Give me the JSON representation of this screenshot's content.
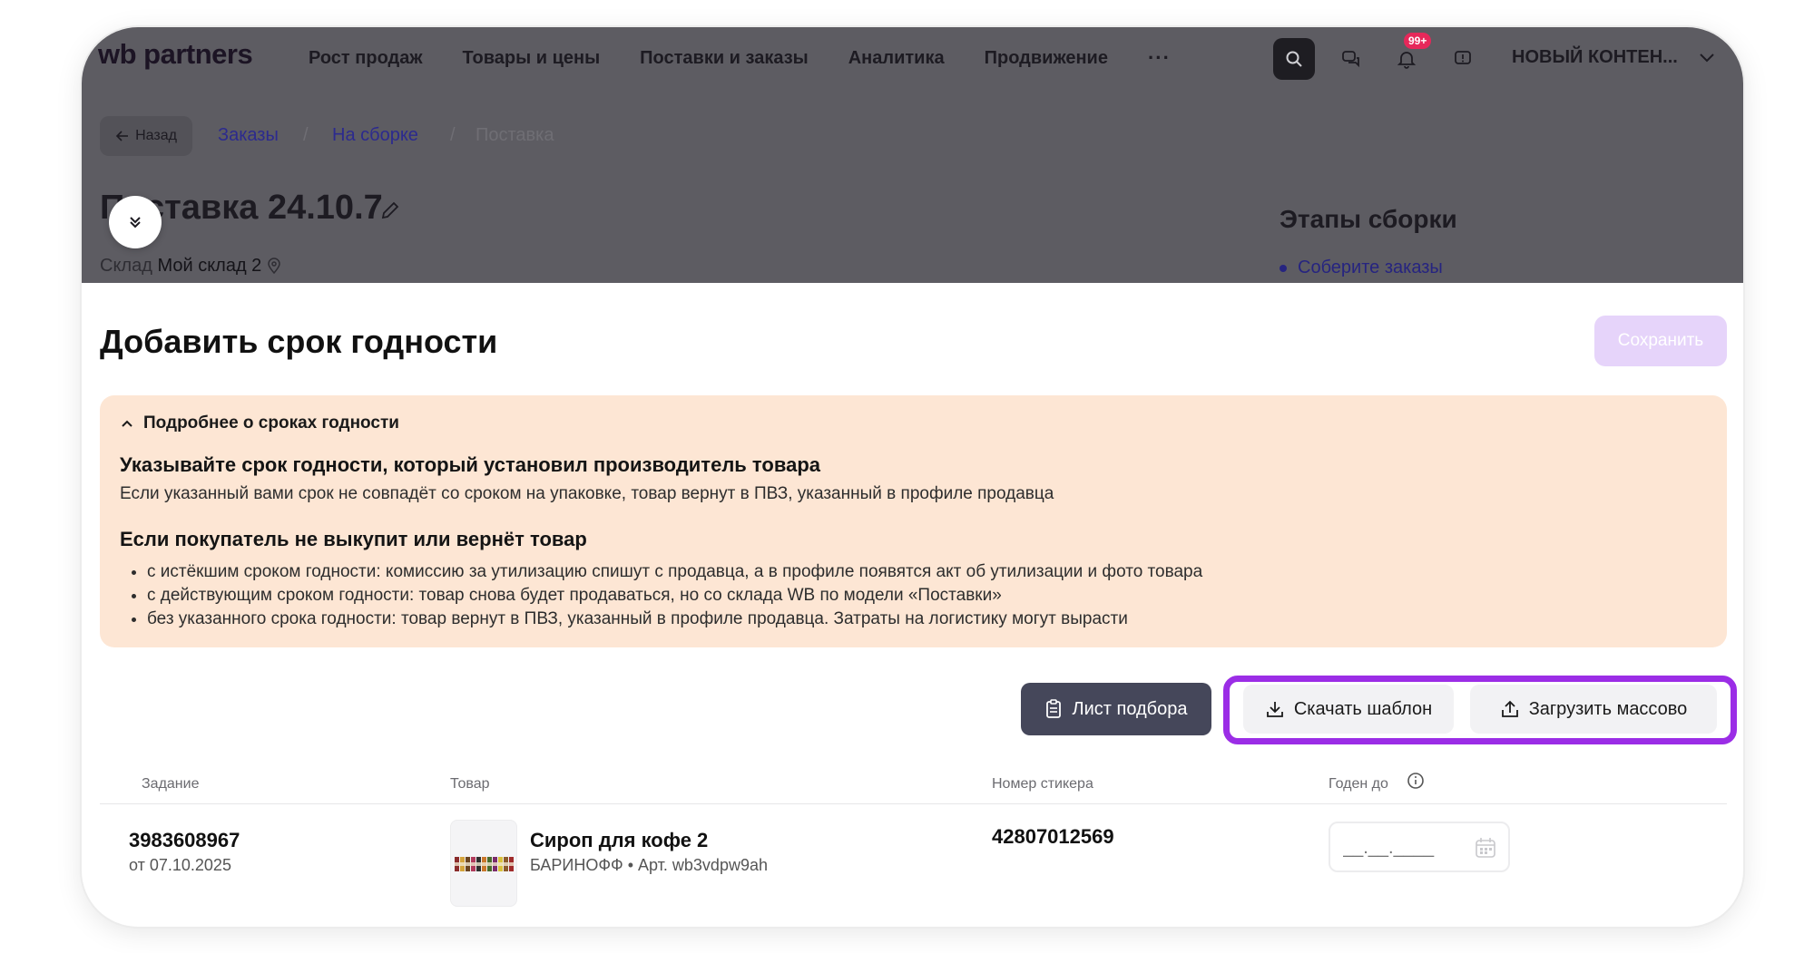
{
  "header": {
    "logo": "wb partners",
    "nav": [
      "Рост продаж",
      "Товары и цены",
      "Поставки и заказы",
      "Аналитика",
      "Продвижение"
    ],
    "more": "···",
    "notifications_badge": "99+",
    "account": "НОВЫЙ КОНТЕН..."
  },
  "breadcrumb": {
    "back": "Назад",
    "items": [
      "Заказы",
      "На сборке",
      "Поставка"
    ],
    "separator": "/"
  },
  "page": {
    "title": "Поставка 24.10.7",
    "warehouse_label": "Склад",
    "warehouse_value": "Мой склад 2"
  },
  "stages": {
    "title": "Этапы сборки",
    "first": "Соберите заказы"
  },
  "modal": {
    "title": "Добавить срок годности",
    "save": "Сохранить"
  },
  "info": {
    "toggle": "Подробнее о сроках годности",
    "heading1": "Указывайте срок годности, который установил производитель товара",
    "text1": "Если указанный вами срок не совпадёт со сроком на упаковке, товар вернут в ПВЗ, указанный в профиле продавца",
    "heading2": "Если покупатель не выкупит или вернёт товар",
    "bullets": [
      "с истёкшим сроком годности: комиссию за утилизацию спишут с продавца, а в профиле появятся акт об утилизации и фото товара",
      "с действующим сроком годности: товар снова будет продаваться, но со склада WB по модели «Поставки»",
      "без указанного срока годности: товар вернут в ПВЗ, указанный в профиле продавца. Затраты на логистику могут вырасти"
    ]
  },
  "actions": {
    "pick_list": "Лист подбора",
    "download_template": "Скачать шаблон",
    "upload_bulk": "Загрузить массово"
  },
  "table": {
    "columns": [
      "Задание",
      "Товар",
      "Номер стикера",
      "Годен до"
    ],
    "rows": [
      {
        "task_id": "3983608967",
        "task_date": "от 07.10.2025",
        "product_name": "Сироп для кофе 2",
        "product_meta": "БАРИНОФФ • Арт. wb3vdpw9ah",
        "sticker": "42807012569",
        "expiry_placeholder": "__.__.____"
      }
    ]
  },
  "colors": {
    "accent_purple": "#9b2de6",
    "save_disabled": "#e6d4fa",
    "info_bg": "#fde6d4",
    "dim_overlay": "#5d5c62"
  }
}
